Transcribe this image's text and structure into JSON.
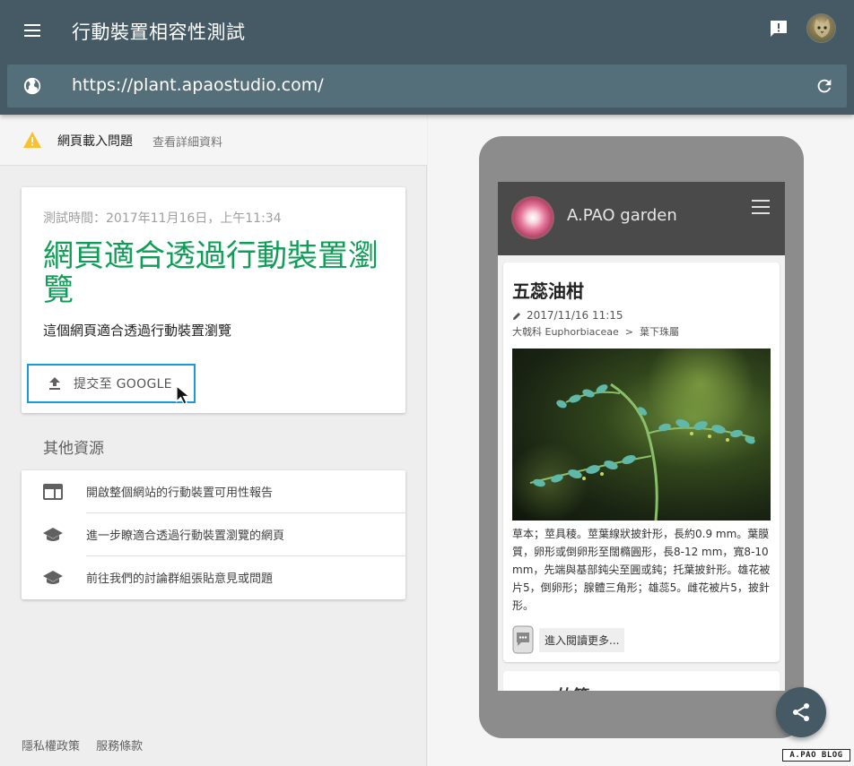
{
  "app": {
    "title": "行動裝置相容性測試",
    "icons": {
      "menu": "menu-icon",
      "feedback": "feedback-icon",
      "avatar": "user-avatar"
    }
  },
  "url_bar": {
    "value": "https://plant.apaostudio.com/",
    "left_icon": "globe-icon",
    "right_icon": "reload-icon"
  },
  "alert": {
    "text": "網頁載入問題",
    "link": "查看詳細資料",
    "icon": "warning-icon",
    "color": "#fbc02d"
  },
  "result": {
    "test_time": "測試時間：2017年11月16日，上午11:34",
    "verdict": "網頁適合透過行動裝置瀏覽",
    "verdict_color": "#0f9d58",
    "description": "這個網頁適合透過行動裝置瀏覽",
    "submit_label": "提交至 GOOGLE",
    "submit_icon": "upload-icon"
  },
  "resources": {
    "heading": "其他資源",
    "items": [
      {
        "label": "開啟整個網站的行動裝置可用性報告",
        "icon": "report-icon"
      },
      {
        "label": "進一步瞭適合透過行動裝置瀏覽的網頁",
        "icon": "school-icon"
      },
      {
        "label": "前往我們的討論群組張貼意見或問題",
        "icon": "school-icon"
      }
    ]
  },
  "footer": {
    "privacy": "隱私權政策",
    "terms": "服務條款"
  },
  "preview": {
    "site_name": "A.PAO garden",
    "post": {
      "title": "五蕊油柑",
      "date": "2017/11/16  11:15",
      "category": "大戟科 Euphorbiaceae",
      "category_sep": ">",
      "subcategory": "葉下珠屬",
      "body": "草本；莖具稜。莖葉線狀披針形，長約0.9 mm。葉膜質，卵形或倒卵形至闊橢圓形，長8-12 mm，寬8-10 mm，先端與基部鈍尖至圓或鈍；托葉披針形。雄花被片5，倒卵形；腺體三角形；雄蕊5。雌花被片5，披針形。",
      "read_more": "進入閱讀更多..."
    },
    "next_post_peek": "一 竹節"
  },
  "share_icon": "share-icon",
  "watermark": "A.PAO BLOG"
}
